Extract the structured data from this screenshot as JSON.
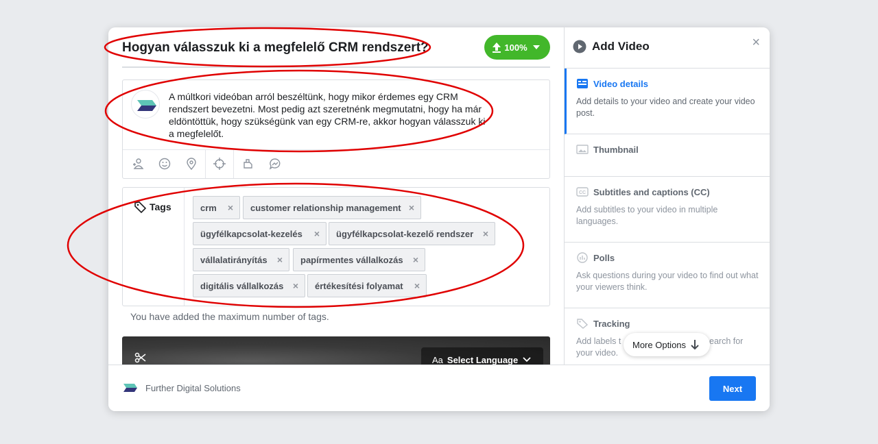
{
  "video_title": "Hogyan válasszuk ki a megfelelő CRM rendszert?",
  "upload": {
    "progress_label": "100%",
    "progress": 1.0
  },
  "description": "A múltkori videóban arról beszéltünk, hogy mikor érdemes egy CRM rendszert bevezetni. Most pedig azt szeretnénk megmutatni, hogy ha már eldöntöttük, hogy szükségünk van egy CRM-re, akkor hogyan válasszuk ki a megfelelőt.",
  "composer_tools": [
    "tag-people-icon",
    "feeling-icon",
    "location-icon",
    "crosshair-icon",
    "sponsor-icon",
    "messenger-icon"
  ],
  "tags": {
    "label": "Tags",
    "items": [
      "crm",
      "customer relationship management",
      "ügyfélkapcsolat-kezelés",
      "ügyfélkapcsolat-kezelő rendszer",
      "vállalatirányítás",
      "papírmentes vállalkozás",
      "digitális vállalkozás",
      "értékesítési folyamat"
    ],
    "remove_glyph": "×",
    "max_message": "You have added the maximum number of tags."
  },
  "preview": {
    "language_button": "Select Language",
    "language_prefix": "Aa"
  },
  "sidebar": {
    "title": "Add Video",
    "close_glyph": "×",
    "steps": [
      {
        "label": "Video details",
        "desc": "Add details to your video and create your video post.",
        "icon": "details-icon",
        "active": true
      },
      {
        "label": "Thumbnail",
        "desc": "",
        "icon": "image-icon",
        "active": false
      },
      {
        "label": "Subtitles and captions (CC)",
        "desc": "Add subtitles to your video in multiple languages.",
        "icon": "cc-icon",
        "active": false
      },
      {
        "label": "Polls",
        "desc": "Ask questions during your video to find out what your viewers think.",
        "icon": "poll-icon",
        "active": false
      },
      {
        "label": "Tracking",
        "desc_part1": "Add labels t",
        "desc_part2": "d search for",
        "desc_part3": "your video.",
        "icon": "tag-icon",
        "active": false
      }
    ],
    "more_options": "More Options"
  },
  "footer": {
    "page_name": "Further Digital Solutions",
    "next_label": "Next"
  },
  "colors": {
    "accent": "#1877f2",
    "upload_green": "#42b72a",
    "annotation_red": "#e00000"
  }
}
